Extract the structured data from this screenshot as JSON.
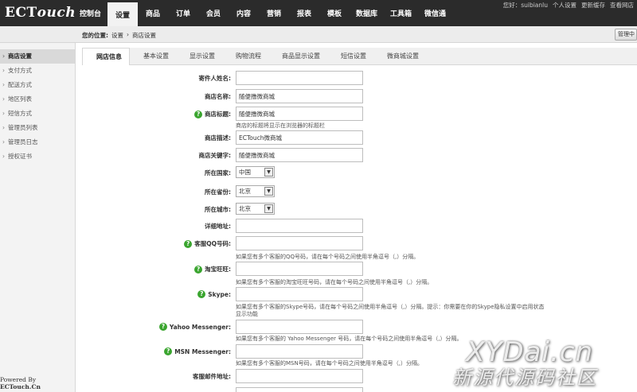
{
  "header": {
    "logo": {
      "main": "ECT",
      "tail": "ouch"
    },
    "nav": [
      {
        "label": "控制台",
        "active": false
      },
      {
        "label": "设置",
        "active": true
      },
      {
        "label": "商品",
        "active": false
      },
      {
        "label": "订单",
        "active": false
      },
      {
        "label": "会员",
        "active": false
      },
      {
        "label": "内容",
        "active": false
      },
      {
        "label": "营销",
        "active": false
      },
      {
        "label": "报表",
        "active": false
      },
      {
        "label": "模板",
        "active": false
      },
      {
        "label": "数据库",
        "active": false
      },
      {
        "label": "工具箱",
        "active": false
      },
      {
        "label": "微信通",
        "active": false
      }
    ],
    "user_links": [
      "您好：suibianlu",
      "个人设置",
      "更新缓存",
      "查看网店"
    ]
  },
  "breadcrumb": {
    "prefix": "您的位置:",
    "items": [
      "设置",
      "›",
      "商店设置"
    ],
    "manage_button": "管理中"
  },
  "sidebar": {
    "items": [
      {
        "label": "商店设置",
        "active": true
      },
      {
        "label": "支付方式",
        "active": false
      },
      {
        "label": "配送方式",
        "active": false
      },
      {
        "label": "地区列表",
        "active": false
      },
      {
        "label": "短信方式",
        "active": false
      },
      {
        "label": "管理员列表",
        "active": false
      },
      {
        "label": "管理员日志",
        "active": false
      },
      {
        "label": "授权证书",
        "active": false
      }
    ],
    "powered": {
      "prefix": "Powered By ",
      "brand": "ECTouch.Cn"
    }
  },
  "tabs": [
    {
      "label": "网店信息",
      "active": true
    },
    {
      "label": "基本设置",
      "active": false
    },
    {
      "label": "显示设置",
      "active": false
    },
    {
      "label": "购物流程",
      "active": false
    },
    {
      "label": "商品显示设置",
      "active": false
    },
    {
      "label": "短信设置",
      "active": false
    },
    {
      "label": "微商城设置",
      "active": false
    }
  ],
  "form": {
    "sender_name": {
      "label": "寄件人姓名:",
      "value": ""
    },
    "shop_name": {
      "label": "商店名称:",
      "value": "随便撸微商城"
    },
    "shop_title": {
      "label": "商店标题:",
      "value": "随便撸微商城",
      "note": "商店的标题将显示在浏览器的标题栏"
    },
    "shop_desc": {
      "label": "商店描述:",
      "value": "ECTouch微商城"
    },
    "shop_keywords": {
      "label": "商店关键字:",
      "value": "随便撸微商城"
    },
    "country": {
      "label": "所在国家:",
      "value": "中国"
    },
    "province": {
      "label": "所在省份:",
      "value": "北京"
    },
    "city": {
      "label": "所在城市:",
      "value": "北京"
    },
    "address": {
      "label": "详细地址:",
      "value": ""
    },
    "qq": {
      "label": "客服QQ号码:",
      "value": "",
      "note": "如果您有多个客服的QQ号码，请在每个号码之间使用半角逗号（,）分隔。"
    },
    "wangwang": {
      "label": "淘宝旺旺:",
      "value": "",
      "note": "如果您有多个客服的淘宝旺旺号码，请在每个号码之间使用半角逗号（,）分隔。"
    },
    "skype": {
      "label": "Skype:",
      "value": "",
      "note": "如果您有多个客服的Skype号码，请在每个号码之间使用半角逗号（,）分隔。提示：你需要在你的Skype隐私设置中启用状态",
      "note2": "显示功能"
    },
    "yahoo": {
      "label": "Yahoo Messenger:",
      "value": "",
      "note": "如果您有多个客服的 Yahoo Messenger 号码，请在每个号码之间使用半角逗号（,）分隔。"
    },
    "msn": {
      "label": "MSN Messenger:",
      "value": "",
      "note": "如果您有多个客服的MSN号码，请在每个号码之间使用半角逗号（,）分隔。"
    },
    "service_email": {
      "label": "客服邮件地址:",
      "value": ""
    }
  },
  "watermark": {
    "line1": "XYDai.cn",
    "line2": "新源代源码社区"
  },
  "colors": {
    "topbar": "#2b2b2b",
    "help_icon": "#3aa52f"
  }
}
